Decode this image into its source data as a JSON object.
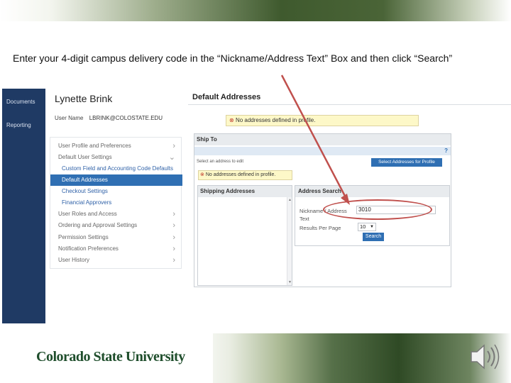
{
  "instruction": "Enter your 4-digit campus delivery code in the “Nickname/Address Text” Box  and then click “Search”",
  "left_nav": {
    "items": [
      "Documents",
      "Reporting"
    ]
  },
  "user_panel": {
    "name": "Lynette Brink",
    "username_label": "User Name",
    "username_value": "LBRINK@COLOSTATE.EDU",
    "menu": [
      {
        "label": "User Profile and Preferences",
        "chevron": "›"
      },
      {
        "label": "Default User Settings",
        "chevron": "⌄"
      },
      {
        "label": "Custom Field and Accounting Code Defaults",
        "chevron": ""
      },
      {
        "label": "Default Addresses",
        "chevron": ""
      },
      {
        "label": "Checkout Settings",
        "chevron": ""
      },
      {
        "label": "Financial Approvers",
        "chevron": ""
      },
      {
        "label": "User Roles and Access",
        "chevron": "›"
      },
      {
        "label": "Ordering and Approval Settings",
        "chevron": "›"
      },
      {
        "label": "Permission Settings",
        "chevron": "›"
      },
      {
        "label": "Notification Preferences",
        "chevron": "›"
      },
      {
        "label": "User History",
        "chevron": "›"
      }
    ]
  },
  "content": {
    "title": "Default Addresses",
    "warning_top": "No addresses defined in profile.",
    "ship_to": {
      "header": "Ship To",
      "help": "?",
      "select_label": "Select an address to edit",
      "select_button": "Select Addresses for Profile",
      "warning": "No addresses defined in profile.",
      "shipping_header": "Shipping Addresses",
      "search": {
        "header": "Address Search",
        "nickname_label_1": "Nickname / Address",
        "nickname_label_2": "Text",
        "nickname_value": "3010",
        "rpp_label": "Results Per Page",
        "rpp_value": "10",
        "search_button": "Search"
      }
    }
  },
  "footer": {
    "logo": "Colorado State University"
  },
  "colors": {
    "nav": "#1f3a64",
    "accent": "#2f6fb3",
    "annotation": "#c0504d",
    "brand": "#1e4d2b"
  }
}
